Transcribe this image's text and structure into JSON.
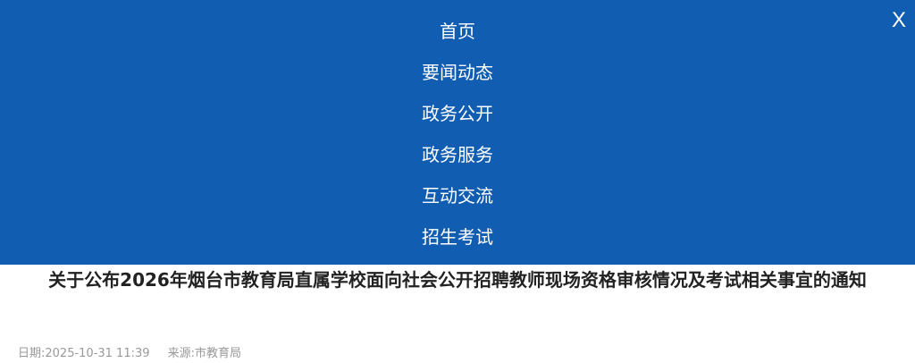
{
  "nav": {
    "items": [
      {
        "label": "首页"
      },
      {
        "label": "要闻动态"
      },
      {
        "label": "政务公开"
      },
      {
        "label": "政务服务"
      },
      {
        "label": "互动交流"
      },
      {
        "label": "招生考试"
      }
    ],
    "close_label": "X"
  },
  "article": {
    "title": "关于公布2026年烟台市教育局直属学校面向社会公开招聘教师现场资格审核情况及考试相关事宜的通知",
    "date": "日期:2025-10-31 11:39",
    "source": "来源:市教育局"
  },
  "colors": {
    "nav_background": "#115db2",
    "nav_text": "#ffffff",
    "title_text": "#222222",
    "meta_text": "#999999"
  }
}
